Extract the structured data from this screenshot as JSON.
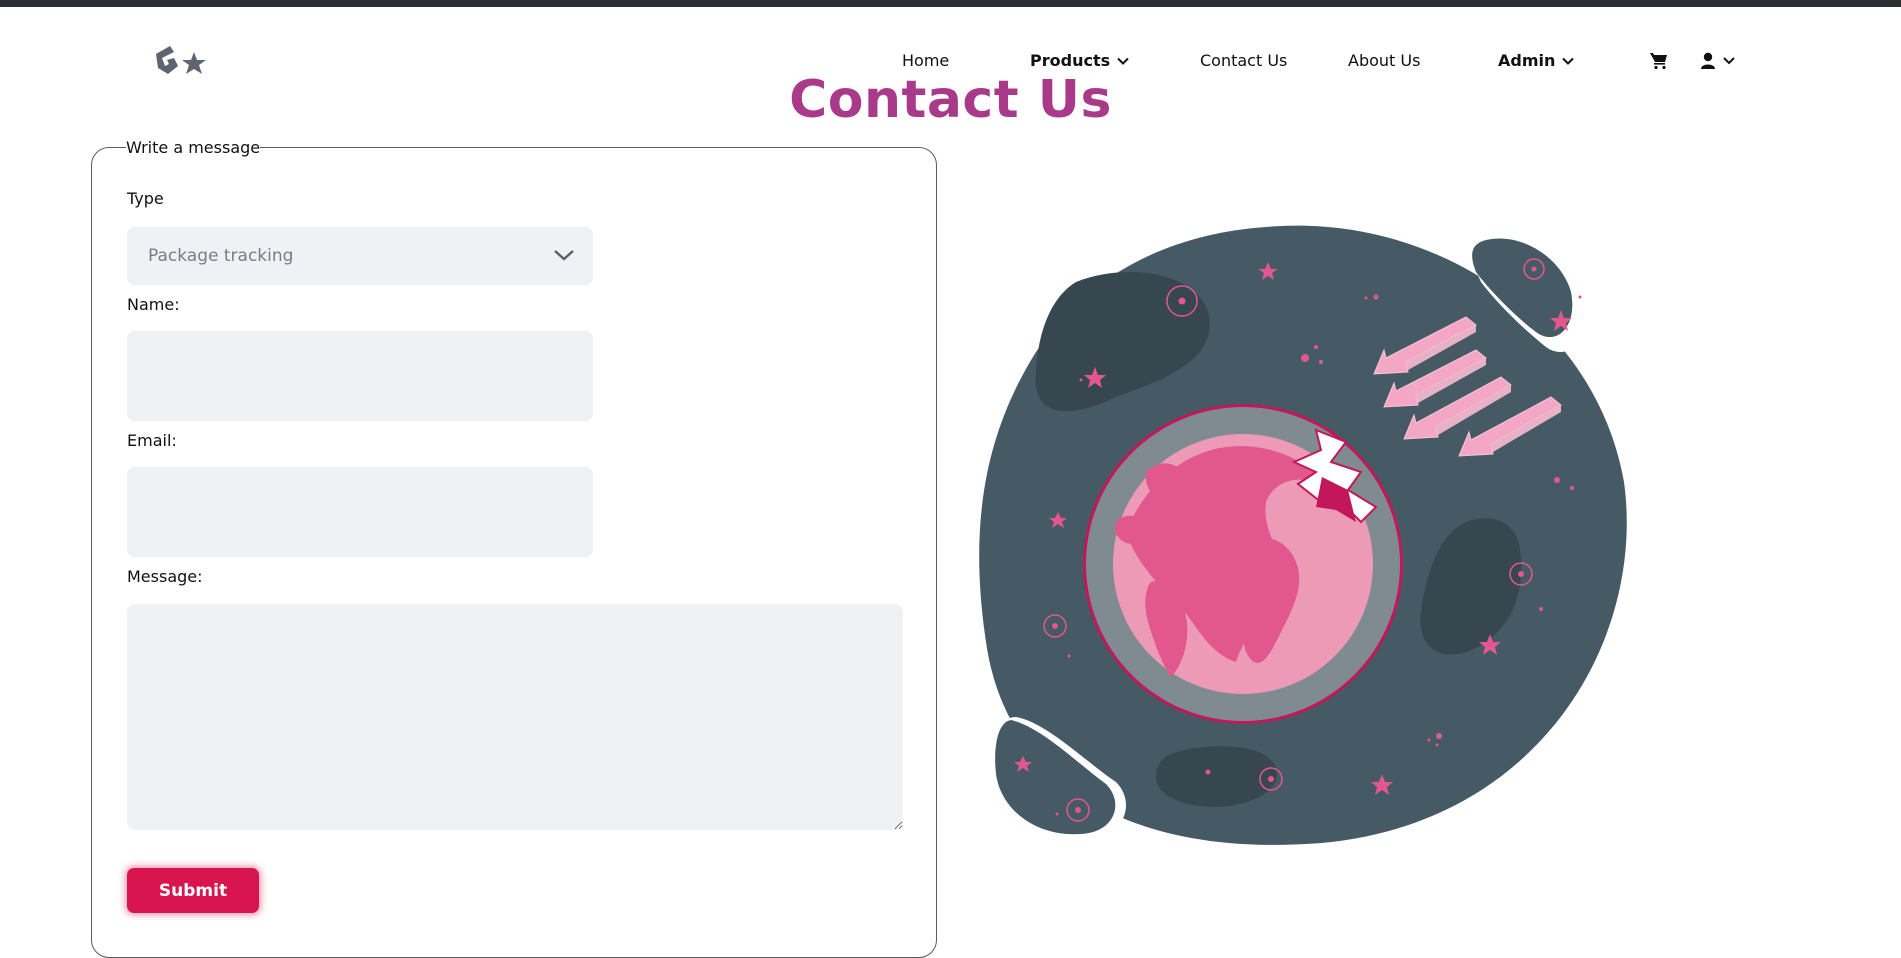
{
  "header": {
    "logo_icon": "logo-g-star-icon",
    "nav": {
      "home": "Home",
      "products": "Products",
      "contact": "Contact Us",
      "about": "About Us",
      "admin": "Admin"
    },
    "icons": {
      "cart": "cart-icon",
      "user": "user-icon",
      "chevron": "chevron-down-icon"
    }
  },
  "page": {
    "title": "Contact Us"
  },
  "form": {
    "legend": "Write a message",
    "type_label": "Type",
    "type_value": "Package tracking",
    "name_label": "Name:",
    "name_value": "",
    "email_label": "Email:",
    "email_value": "",
    "message_label": "Message:",
    "message_value": "",
    "submit_label": "Submit"
  },
  "colors": {
    "accent": "#d9154f",
    "title": "#a93a8a",
    "field_bg": "#f0f1f5",
    "illustration_bg": "#455a64",
    "illustration_pink": "#e3578f"
  }
}
